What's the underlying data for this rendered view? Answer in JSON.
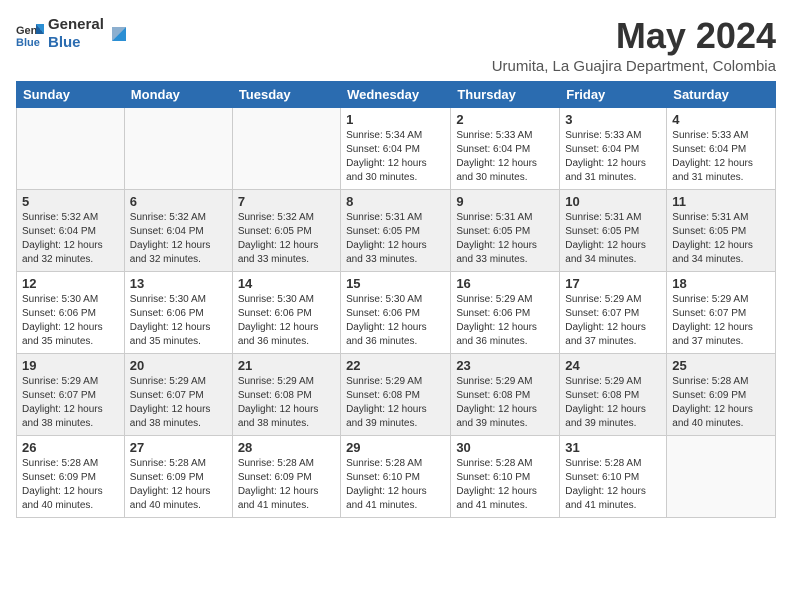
{
  "header": {
    "logo_general": "General",
    "logo_blue": "Blue",
    "month_year": "May 2024",
    "location": "Urumita, La Guajira Department, Colombia"
  },
  "days_of_week": [
    "Sunday",
    "Monday",
    "Tuesday",
    "Wednesday",
    "Thursday",
    "Friday",
    "Saturday"
  ],
  "weeks": [
    [
      {
        "day": "",
        "content": ""
      },
      {
        "day": "",
        "content": ""
      },
      {
        "day": "",
        "content": ""
      },
      {
        "day": "1",
        "content": "Sunrise: 5:34 AM\nSunset: 6:04 PM\nDaylight: 12 hours\nand 30 minutes."
      },
      {
        "day": "2",
        "content": "Sunrise: 5:33 AM\nSunset: 6:04 PM\nDaylight: 12 hours\nand 30 minutes."
      },
      {
        "day": "3",
        "content": "Sunrise: 5:33 AM\nSunset: 6:04 PM\nDaylight: 12 hours\nand 31 minutes."
      },
      {
        "day": "4",
        "content": "Sunrise: 5:33 AM\nSunset: 6:04 PM\nDaylight: 12 hours\nand 31 minutes."
      }
    ],
    [
      {
        "day": "5",
        "content": "Sunrise: 5:32 AM\nSunset: 6:04 PM\nDaylight: 12 hours\nand 32 minutes."
      },
      {
        "day": "6",
        "content": "Sunrise: 5:32 AM\nSunset: 6:04 PM\nDaylight: 12 hours\nand 32 minutes."
      },
      {
        "day": "7",
        "content": "Sunrise: 5:32 AM\nSunset: 6:05 PM\nDaylight: 12 hours\nand 33 minutes."
      },
      {
        "day": "8",
        "content": "Sunrise: 5:31 AM\nSunset: 6:05 PM\nDaylight: 12 hours\nand 33 minutes."
      },
      {
        "day": "9",
        "content": "Sunrise: 5:31 AM\nSunset: 6:05 PM\nDaylight: 12 hours\nand 33 minutes."
      },
      {
        "day": "10",
        "content": "Sunrise: 5:31 AM\nSunset: 6:05 PM\nDaylight: 12 hours\nand 34 minutes."
      },
      {
        "day": "11",
        "content": "Sunrise: 5:31 AM\nSunset: 6:05 PM\nDaylight: 12 hours\nand 34 minutes."
      }
    ],
    [
      {
        "day": "12",
        "content": "Sunrise: 5:30 AM\nSunset: 6:06 PM\nDaylight: 12 hours\nand 35 minutes."
      },
      {
        "day": "13",
        "content": "Sunrise: 5:30 AM\nSunset: 6:06 PM\nDaylight: 12 hours\nand 35 minutes."
      },
      {
        "day": "14",
        "content": "Sunrise: 5:30 AM\nSunset: 6:06 PM\nDaylight: 12 hours\nand 36 minutes."
      },
      {
        "day": "15",
        "content": "Sunrise: 5:30 AM\nSunset: 6:06 PM\nDaylight: 12 hours\nand 36 minutes."
      },
      {
        "day": "16",
        "content": "Sunrise: 5:29 AM\nSunset: 6:06 PM\nDaylight: 12 hours\nand 36 minutes."
      },
      {
        "day": "17",
        "content": "Sunrise: 5:29 AM\nSunset: 6:07 PM\nDaylight: 12 hours\nand 37 minutes."
      },
      {
        "day": "18",
        "content": "Sunrise: 5:29 AM\nSunset: 6:07 PM\nDaylight: 12 hours\nand 37 minutes."
      }
    ],
    [
      {
        "day": "19",
        "content": "Sunrise: 5:29 AM\nSunset: 6:07 PM\nDaylight: 12 hours\nand 38 minutes."
      },
      {
        "day": "20",
        "content": "Sunrise: 5:29 AM\nSunset: 6:07 PM\nDaylight: 12 hours\nand 38 minutes."
      },
      {
        "day": "21",
        "content": "Sunrise: 5:29 AM\nSunset: 6:08 PM\nDaylight: 12 hours\nand 38 minutes."
      },
      {
        "day": "22",
        "content": "Sunrise: 5:29 AM\nSunset: 6:08 PM\nDaylight: 12 hours\nand 39 minutes."
      },
      {
        "day": "23",
        "content": "Sunrise: 5:29 AM\nSunset: 6:08 PM\nDaylight: 12 hours\nand 39 minutes."
      },
      {
        "day": "24",
        "content": "Sunrise: 5:29 AM\nSunset: 6:08 PM\nDaylight: 12 hours\nand 39 minutes."
      },
      {
        "day": "25",
        "content": "Sunrise: 5:28 AM\nSunset: 6:09 PM\nDaylight: 12 hours\nand 40 minutes."
      }
    ],
    [
      {
        "day": "26",
        "content": "Sunrise: 5:28 AM\nSunset: 6:09 PM\nDaylight: 12 hours\nand 40 minutes."
      },
      {
        "day": "27",
        "content": "Sunrise: 5:28 AM\nSunset: 6:09 PM\nDaylight: 12 hours\nand 40 minutes."
      },
      {
        "day": "28",
        "content": "Sunrise: 5:28 AM\nSunset: 6:09 PM\nDaylight: 12 hours\nand 41 minutes."
      },
      {
        "day": "29",
        "content": "Sunrise: 5:28 AM\nSunset: 6:10 PM\nDaylight: 12 hours\nand 41 minutes."
      },
      {
        "day": "30",
        "content": "Sunrise: 5:28 AM\nSunset: 6:10 PM\nDaylight: 12 hours\nand 41 minutes."
      },
      {
        "day": "31",
        "content": "Sunrise: 5:28 AM\nSunset: 6:10 PM\nDaylight: 12 hours\nand 41 minutes."
      },
      {
        "day": "",
        "content": ""
      }
    ]
  ]
}
